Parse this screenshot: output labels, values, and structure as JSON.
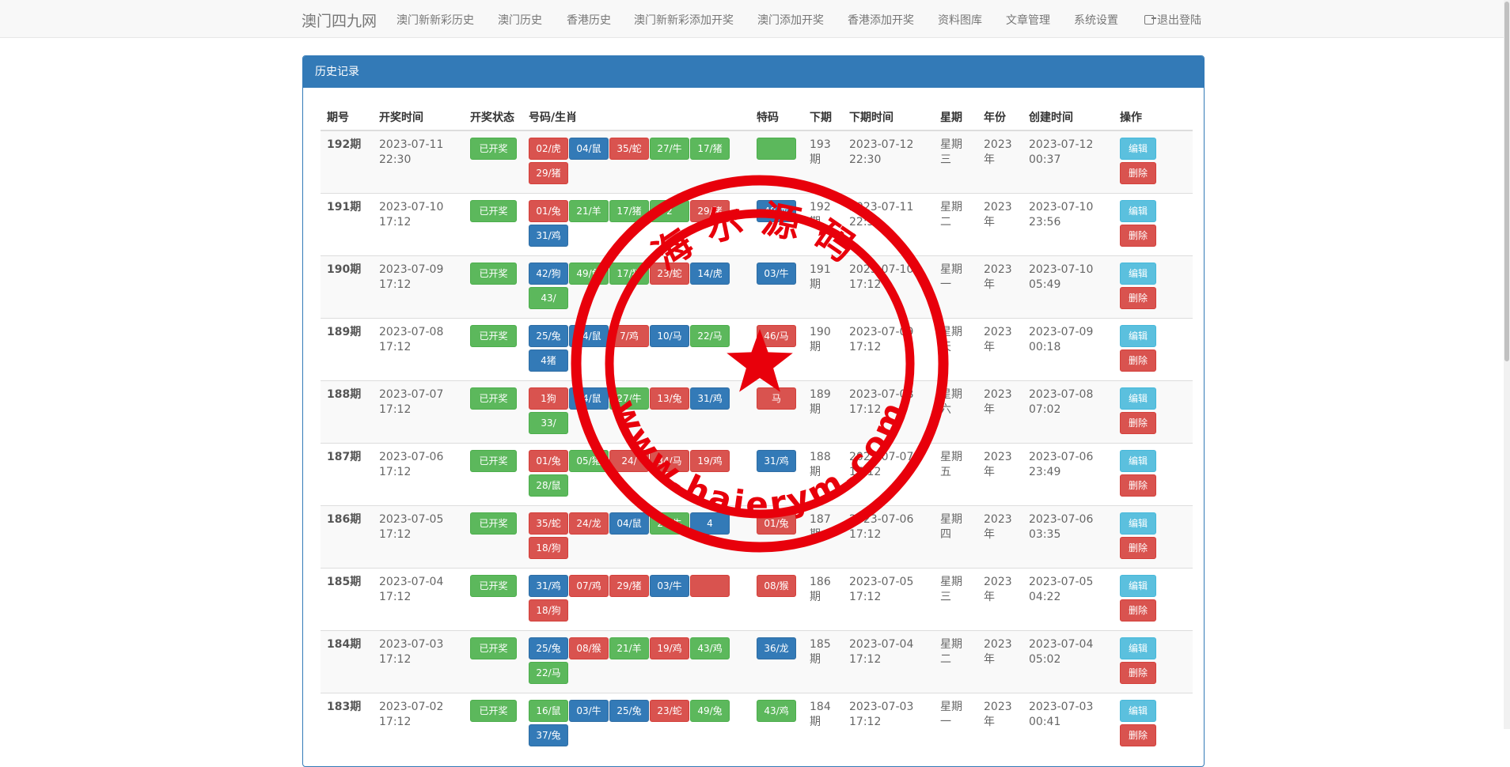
{
  "navbar": {
    "brand": "澳门四九网",
    "links": [
      "澳门新新彩历史",
      "澳门历史",
      "香港历史",
      "澳门新新彩添加开奖",
      "澳门添加开奖",
      "香港添加开奖",
      "资料图库",
      "文章管理",
      "系统设置"
    ],
    "logout": "退出登陆"
  },
  "panel": {
    "title": "历史记录"
  },
  "table": {
    "headers": [
      "期号",
      "开奖时间",
      "开奖状态",
      "号码/生肖",
      "特码",
      "下期",
      "下期时间",
      "星期",
      "年份",
      "创建时间",
      "操作"
    ],
    "edit_label": "编辑",
    "delete_label": "删除",
    "rows": [
      {
        "period": "192期",
        "draw_time": "2023-07-11 22:30",
        "status": "已开奖",
        "balls": [
          {
            "t": "02/虎",
            "c": "red"
          },
          {
            "t": "04/鼠",
            "c": "blue"
          },
          {
            "t": "35/蛇",
            "c": "red"
          },
          {
            "t": "27/牛",
            "c": "green"
          },
          {
            "t": "17/猪",
            "c": "green"
          },
          {
            "t": "29/猪",
            "c": "red"
          }
        ],
        "special": {
          "t": "",
          "c": "green"
        },
        "next": "193期",
        "next_time": "2023-07-12 22:30",
        "weekday": "星期三",
        "year": "2023年",
        "created": "2023-07-12 00:37"
      },
      {
        "period": "191期",
        "draw_time": "2023-07-10 17:12",
        "status": "已开奖",
        "balls": [
          {
            "t": "01/兔",
            "c": "red"
          },
          {
            "t": "21/羊",
            "c": "green"
          },
          {
            "t": "17/猪",
            "c": "green"
          },
          {
            "t": "2",
            "c": "green"
          },
          {
            "t": "29/猪",
            "c": "red"
          },
          {
            "t": "31/鸡",
            "c": "blue"
          }
        ],
        "special": {
          "t": "48/龙",
          "c": "blue"
        },
        "next": "192期",
        "next_time": "2023-07-11 22:30",
        "weekday": "星期二",
        "year": "2023年",
        "created": "2023-07-10 23:56"
      },
      {
        "period": "190期",
        "draw_time": "2023-07-09 17:12",
        "status": "已开奖",
        "balls": [
          {
            "t": "42/狗",
            "c": "blue"
          },
          {
            "t": "49/兔",
            "c": "green"
          },
          {
            "t": "17/猪",
            "c": "green"
          },
          {
            "t": "23/蛇",
            "c": "red"
          },
          {
            "t": "14/虎",
            "c": "blue"
          },
          {
            "t": "43/",
            "c": "green"
          }
        ],
        "special": {
          "t": "03/牛",
          "c": "blue"
        },
        "next": "191期",
        "next_time": "2023-07-10 17:12",
        "weekday": "星期一",
        "year": "2023年",
        "created": "2023-07-10 05:49"
      },
      {
        "period": "189期",
        "draw_time": "2023-07-08 17:12",
        "status": "已开奖",
        "balls": [
          {
            "t": "25/兔",
            "c": "blue"
          },
          {
            "t": "04/鼠",
            "c": "blue"
          },
          {
            "t": "7/鸡",
            "c": "red"
          },
          {
            "t": "10/马",
            "c": "blue"
          },
          {
            "t": "22/马",
            "c": "green"
          },
          {
            "t": "4猪",
            "c": "blue"
          }
        ],
        "special": {
          "t": "46/马",
          "c": "red"
        },
        "next": "190期",
        "next_time": "2023-07-09 17:12",
        "weekday": "星期天",
        "year": "2023年",
        "created": "2023-07-09 00:18"
      },
      {
        "period": "188期",
        "draw_time": "2023-07-07 17:12",
        "status": "已开奖",
        "balls": [
          {
            "t": "1狗",
            "c": "red"
          },
          {
            "t": "04/鼠",
            "c": "blue"
          },
          {
            "t": "27/牛",
            "c": "green"
          },
          {
            "t": "13/兔",
            "c": "red"
          },
          {
            "t": "31/鸡",
            "c": "blue"
          },
          {
            "t": "33/",
            "c": "green"
          }
        ],
        "special": {
          "t": "马",
          "c": "red"
        },
        "next": "189期",
        "next_time": "2023-07-08 17:12",
        "weekday": "星期六",
        "year": "2023年",
        "created": "2023-07-08 07:02"
      },
      {
        "period": "187期",
        "draw_time": "2023-07-06 17:12",
        "status": "已开奖",
        "balls": [
          {
            "t": "01/兔",
            "c": "red"
          },
          {
            "t": "05/猪",
            "c": "green"
          },
          {
            "t": "24/",
            "c": "red"
          },
          {
            "t": "34/马",
            "c": "red"
          },
          {
            "t": "19/鸡",
            "c": "red"
          },
          {
            "t": "28/鼠",
            "c": "green"
          }
        ],
        "special": {
          "t": "31/鸡",
          "c": "blue"
        },
        "next": "188期",
        "next_time": "2023-07-07 17:12",
        "weekday": "星期五",
        "year": "2023年",
        "created": "2023-07-06 23:49"
      },
      {
        "period": "186期",
        "draw_time": "2023-07-05 17:12",
        "status": "已开奖",
        "balls": [
          {
            "t": "35/蛇",
            "c": "red"
          },
          {
            "t": "24/龙",
            "c": "red"
          },
          {
            "t": "04/鼠",
            "c": "blue"
          },
          {
            "t": "27/牛",
            "c": "green"
          },
          {
            "t": "4",
            "c": "blue"
          },
          {
            "t": "18/狗",
            "c": "red"
          }
        ],
        "special": {
          "t": "01/兔",
          "c": "red"
        },
        "next": "187期",
        "next_time": "2023-07-06 17:12",
        "weekday": "星期四",
        "year": "2023年",
        "created": "2023-07-06 03:35"
      },
      {
        "period": "185期",
        "draw_time": "2023-07-04 17:12",
        "status": "已开奖",
        "balls": [
          {
            "t": "31/鸡",
            "c": "blue"
          },
          {
            "t": "07/鸡",
            "c": "red"
          },
          {
            "t": "29/猪",
            "c": "red"
          },
          {
            "t": "03/牛",
            "c": "blue"
          },
          {
            "t": "",
            "c": "red"
          },
          {
            "t": "18/狗",
            "c": "red"
          }
        ],
        "special": {
          "t": "08/猴",
          "c": "red"
        },
        "next": "186期",
        "next_time": "2023-07-05 17:12",
        "weekday": "星期三",
        "year": "2023年",
        "created": "2023-07-05 04:22"
      },
      {
        "period": "184期",
        "draw_time": "2023-07-03 17:12",
        "status": "已开奖",
        "balls": [
          {
            "t": "25/兔",
            "c": "blue"
          },
          {
            "t": "08/猴",
            "c": "red"
          },
          {
            "t": "21/羊",
            "c": "green"
          },
          {
            "t": "19/鸡",
            "c": "red"
          },
          {
            "t": "43/鸡",
            "c": "green"
          },
          {
            "t": "22/马",
            "c": "green"
          }
        ],
        "special": {
          "t": "36/龙",
          "c": "blue"
        },
        "next": "185期",
        "next_time": "2023-07-04 17:12",
        "weekday": "星期二",
        "year": "2023年",
        "created": "2023-07-04 05:02"
      },
      {
        "period": "183期",
        "draw_time": "2023-07-02 17:12",
        "status": "已开奖",
        "balls": [
          {
            "t": "16/鼠",
            "c": "green"
          },
          {
            "t": "03/牛",
            "c": "blue"
          },
          {
            "t": "25/兔",
            "c": "blue"
          },
          {
            "t": "23/蛇",
            "c": "red"
          },
          {
            "t": "49/兔",
            "c": "green"
          },
          {
            "t": "37/兔",
            "c": "blue"
          }
        ],
        "special": {
          "t": "43/鸡",
          "c": "green"
        },
        "next": "184期",
        "next_time": "2023-07-03 17:12",
        "weekday": "星期一",
        "year": "2023年",
        "created": "2023-07-03 00:41"
      }
    ]
  },
  "stamp": {
    "top_text": "海尔源码",
    "bottom_text": "www.haierym.com",
    "color": "#e8000b"
  }
}
